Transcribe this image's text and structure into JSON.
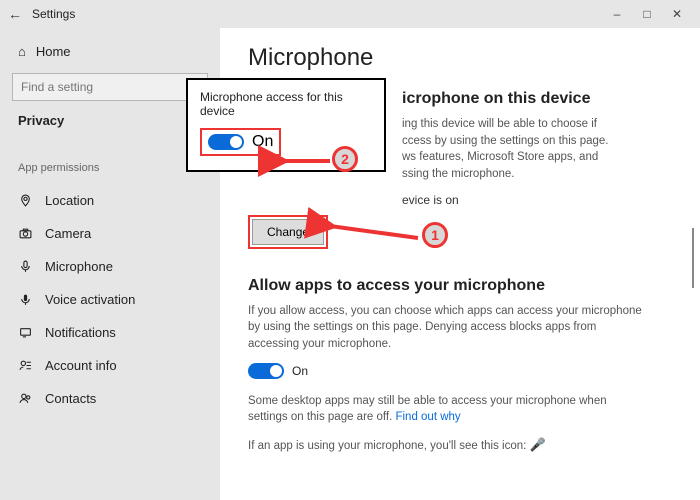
{
  "window": {
    "title": "Settings"
  },
  "sidebar": {
    "home": "Home",
    "search_placeholder": "Find a setting",
    "section": "Privacy",
    "group": "App permissions",
    "items": [
      {
        "label": "Location"
      },
      {
        "label": "Camera"
      },
      {
        "label": "Microphone"
      },
      {
        "label": "Voice activation"
      },
      {
        "label": "Notifications"
      },
      {
        "label": "Account info"
      },
      {
        "label": "Contacts"
      }
    ]
  },
  "main": {
    "title": "Microphone",
    "section1_heading_full": "Allow access to the microphone on this device",
    "section1_heading_visible": "icrophone on this device",
    "section1_body_visible": "ing this device will be able to choose if\n ccess by using the settings on this page.\nws features, Microsoft Store apps, and\n ssing the microphone.",
    "status_visible": "evice is on",
    "change": "Change",
    "section2_heading": "Allow apps to access your microphone",
    "section2_body": "If you allow access, you can choose which apps can access your microphone by using the settings on this page. Denying access blocks apps from accessing your microphone.",
    "toggle2_state": "On",
    "desktop_note_a": "Some desktop apps may still be able to access your microphone when settings on this page are off. ",
    "desktop_note_link": "Find out why",
    "using_note": "If an app is using your microphone, you'll see this icon:"
  },
  "popup": {
    "label": "Microphone access for this device",
    "toggle_state": "On"
  },
  "annotations": {
    "step1": "1",
    "step2": "2"
  }
}
